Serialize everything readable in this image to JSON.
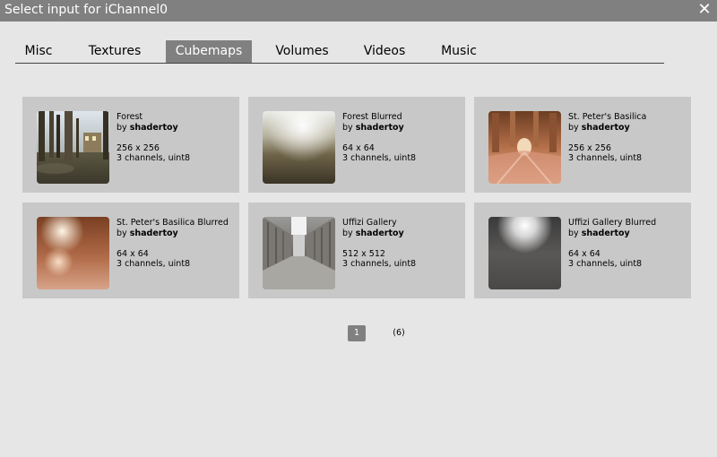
{
  "dialog": {
    "title": "Select input for iChannel0",
    "close_icon": "close-icon"
  },
  "tabs": [
    {
      "label": "Misc"
    },
    {
      "label": "Textures"
    },
    {
      "label": "Cubemaps",
      "active": true
    },
    {
      "label": "Volumes"
    },
    {
      "label": "Videos"
    },
    {
      "label": "Music"
    }
  ],
  "cards": [
    {
      "name": "Forest",
      "by": "by",
      "author": "shadertoy",
      "size": "256 x 256",
      "format": "3 channels, uint8"
    },
    {
      "name": "Forest Blurred",
      "by": "by",
      "author": "shadertoy",
      "size": "64 x 64",
      "format": "3 channels, uint8"
    },
    {
      "name": "St. Peter's Basilica",
      "by": "by",
      "author": "shadertoy",
      "size": "256 x 256",
      "format": "3 channels, uint8"
    },
    {
      "name": "St. Peter's Basilica Blurred",
      "by": "by",
      "author": "shadertoy",
      "size": "64 x 64",
      "format": "3 channels, uint8"
    },
    {
      "name": "Uffizi Gallery",
      "by": "by",
      "author": "shadertoy",
      "size": "512 x 512",
      "format": "3 channels, uint8"
    },
    {
      "name": "Uffizi Gallery Blurred",
      "by": "by",
      "author": "shadertoy",
      "size": "64 x 64",
      "format": "3 channels, uint8"
    }
  ],
  "pagination": {
    "current": "1",
    "total": "(6)"
  },
  "colors": {
    "titlebar": "#808080",
    "active_tab": "#808080",
    "card": "#c8c8c8",
    "background": "#e6e6e6"
  }
}
